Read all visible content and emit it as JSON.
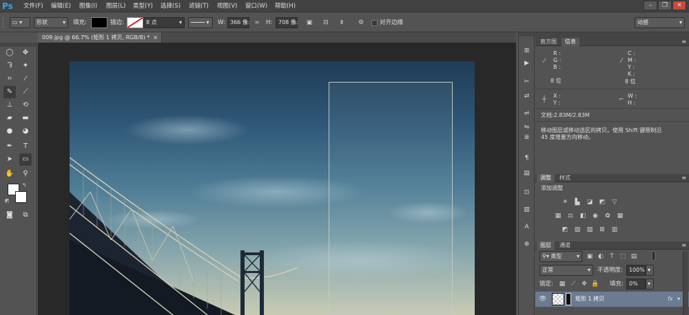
{
  "menubar": {
    "logo": "Ps",
    "items": [
      "文件(F)",
      "编辑(E)",
      "图像(I)",
      "图层(L)",
      "类型(Y)",
      "选择(S)",
      "滤镜(T)",
      "视图(V)",
      "窗口(W)",
      "帮助(H)"
    ],
    "window_buttons": [
      "–",
      "❐",
      "✕"
    ]
  },
  "options_bar": {
    "mode_value": "形状",
    "fill_label": "填充:",
    "stroke_label": "描边:",
    "stroke_width": "8 点",
    "w_label": "W:",
    "w_value": "366 像:",
    "h_label": "H:",
    "h_value": "708 像:",
    "align_edges_label": "对齐边缘",
    "workspace_value": "动感"
  },
  "document": {
    "tab_title": "009.jpg @ 66.7% (矩形 1 拷贝, RGB/8) *",
    "tab_close": "×"
  },
  "info_panel": {
    "tabs": [
      "直方图",
      "信息"
    ],
    "active_tab": "信息",
    "left_channels": [
      "R :",
      "G :",
      "B :"
    ],
    "right_channels": [
      "C :",
      "M :",
      "Y :",
      "K :"
    ],
    "bit_left": "8 位",
    "bit_right": "8 位",
    "xy_labels": [
      "X :",
      "Y :"
    ],
    "wh_labels": [
      "W :",
      "H :"
    ],
    "doc_size": "文档:2.83M/2.83M",
    "hint_line1": "移动图层或移动选区的拷贝。使用 Shift 键限制沿",
    "hint_line2": "45 度增量方向移动。"
  },
  "adjustments_panel": {
    "tabs": [
      "调整",
      "样式"
    ],
    "active_tab": "调整",
    "title": "添加调整"
  },
  "layers_panel": {
    "tabs": [
      "图层",
      "通道"
    ],
    "active_tab": "图层",
    "filter_value": "类型",
    "blend_mode": "正常",
    "opacity_label": "不透明度:",
    "opacity_value": "100%",
    "lock_label": "锁定:",
    "fill_label": "填充:",
    "fill_value": "0%",
    "layer_name": "矩形 1 拷贝",
    "layer_fx": "fx"
  },
  "colors": {
    "accent": "#3aa3e8",
    "selected_layer": "#6b7b92",
    "foreground": "#ffffff",
    "background": "#ffffff"
  }
}
